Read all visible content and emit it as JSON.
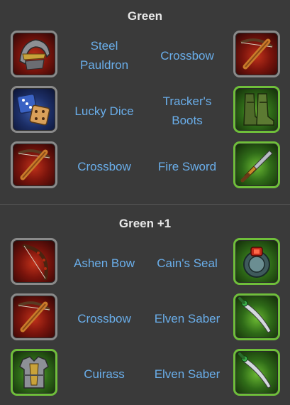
{
  "sections": [
    {
      "title": "Green",
      "rows": [
        {
          "left": {
            "name": "Steel Pauldron",
            "icon": "pauldron-icon"
          },
          "right": {
            "name": "Crossbow",
            "icon": "crossbow-icon"
          }
        },
        {
          "left": {
            "name": "Lucky Dice",
            "icon": "dice-icon"
          },
          "right": {
            "name": "Tracker's Boots",
            "icon": "boots-icon"
          }
        },
        {
          "left": {
            "name": "Crossbow",
            "icon": "crossbow-icon"
          },
          "right": {
            "name": "Fire Sword",
            "icon": "sword-icon"
          }
        }
      ]
    },
    {
      "title": "Green +1",
      "rows": [
        {
          "left": {
            "name": "Ashen Bow",
            "icon": "bow-icon"
          },
          "right": {
            "name": "Cain's Seal",
            "icon": "seal-icon"
          }
        },
        {
          "left": {
            "name": "Crossbow",
            "icon": "crossbow-icon"
          },
          "right": {
            "name": "Elven Saber",
            "icon": "saber-icon"
          }
        },
        {
          "left": {
            "name": "Cuirass",
            "icon": "cuirass-icon"
          },
          "right": {
            "name": "Elven Saber",
            "icon": "saber-icon"
          }
        }
      ]
    }
  ],
  "colors": {
    "background": "#3a3a3a",
    "label": "#6aaeea",
    "title": "#e8e8e8",
    "green_frame": "#6fbf3a"
  }
}
